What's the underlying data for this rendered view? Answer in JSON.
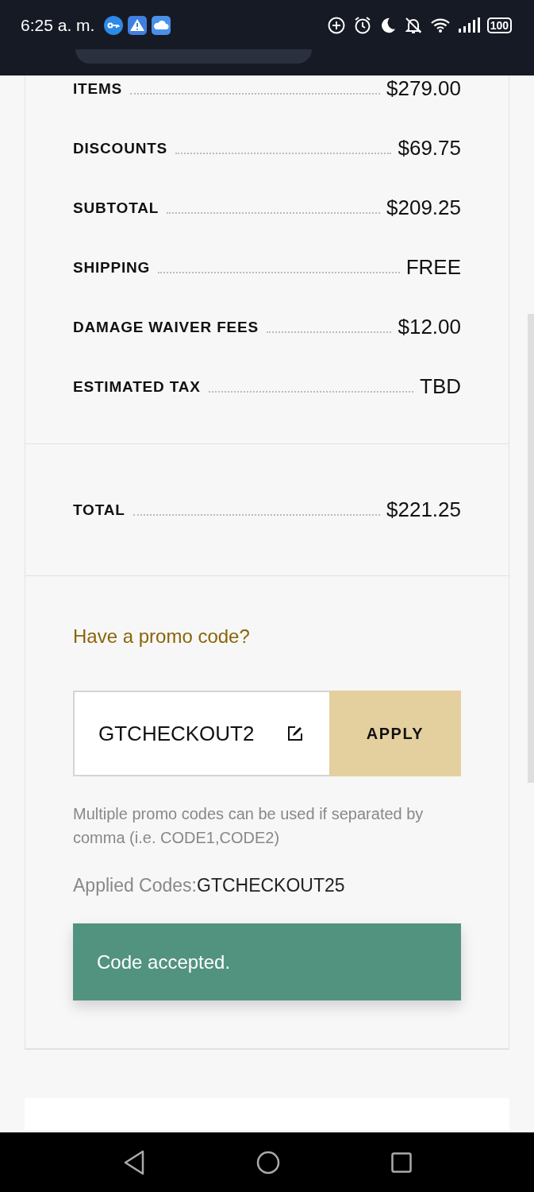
{
  "status_bar": {
    "time": "6:25 a. m.",
    "battery": "100"
  },
  "summary": {
    "rows": [
      {
        "label": "ITEMS",
        "value": "$279.00"
      },
      {
        "label": "DISCOUNTS",
        "value": "$69.75"
      },
      {
        "label": "SUBTOTAL",
        "value": "$209.25"
      },
      {
        "label": "SHIPPING",
        "value": "FREE"
      },
      {
        "label": "DAMAGE WAIVER FEES",
        "value": "$12.00"
      },
      {
        "label": "ESTIMATED TAX",
        "value": "TBD"
      }
    ],
    "total": {
      "label": "TOTAL",
      "value": "$221.25"
    }
  },
  "promo": {
    "link": "Have a promo code?",
    "value": "GTCHECKOUT2",
    "button": "APPLY",
    "note": "Multiple promo codes can be used if separated by comma (i.e. CODE1,CODE2)",
    "applied_label": "Applied Codes:",
    "applied_value": "GTCHECKOUT25",
    "toast": "Code accepted."
  }
}
